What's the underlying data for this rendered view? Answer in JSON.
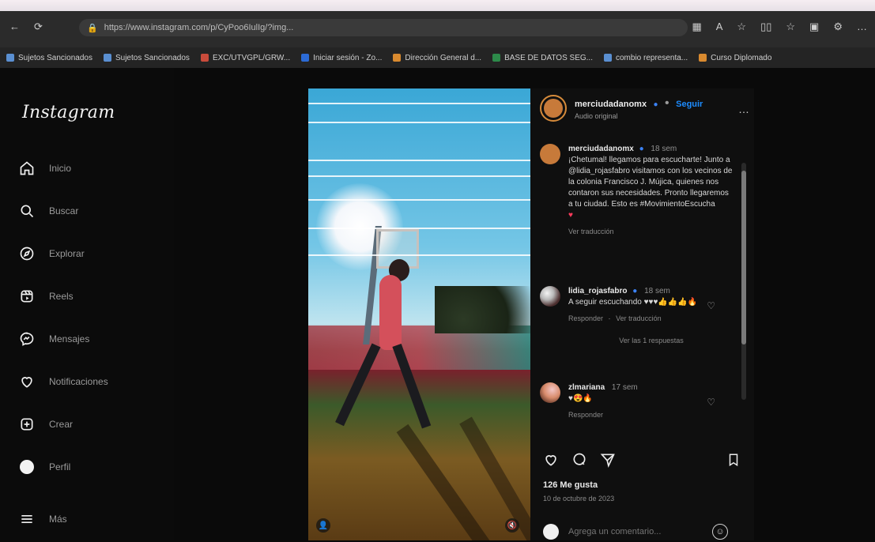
{
  "browser": {
    "url": "https://www.instagram.com/p/CyPoo6IulIg/?img...",
    "bookmarks": [
      "Sujetos Sancionados",
      "Sujetos Sancionados",
      "EXC/UTVGPL/GRW...",
      "Iniciar sesión - Zo...",
      "Dirección General d...",
      "BASE DE DATOS SEG...",
      "combio representa...",
      "Curso Diplomado "
    ]
  },
  "sidebar": {
    "logo": "Instagram",
    "items": [
      {
        "label": "Inicio",
        "icon": "home-icon"
      },
      {
        "label": "Buscar",
        "icon": "search-icon"
      },
      {
        "label": "Explorar",
        "icon": "compass-icon"
      },
      {
        "label": "Reels",
        "icon": "reels-icon"
      },
      {
        "label": "Mensajes",
        "icon": "messenger-icon"
      },
      {
        "label": "Notificaciones",
        "icon": "heart-icon"
      },
      {
        "label": "Crear",
        "icon": "plus-square-icon"
      },
      {
        "label": "Perfil",
        "icon": "profile-avatar"
      },
      {
        "label": "Más",
        "icon": "menu-icon"
      }
    ]
  },
  "post": {
    "username": "merciudadanomx",
    "follow_label": "Seguir",
    "audio": "Audio original",
    "caption_user": "merciudadanomx",
    "caption_time": "18 sem",
    "caption": "¡Chetumal! llegamos para escucharte! Junto a @lidia_rojasfabro visitamos con los vecinos de la colonia Francisco J. Mújica, quienes nos contaron sus necesidades. Pronto llegaremos a tu ciudad. Esto es #MovimientoEscucha",
    "caption_heart": "♥",
    "see_translation": "Ver traducción",
    "comments": [
      {
        "user": "lidia_rojasfabro",
        "time": "18 sem",
        "text": "A seguir escuchando ♥♥♥👍👍👍🔥",
        "reply": "Responder",
        "translate": "Ver traducción",
        "view_replies": "Ver las 1 respuestas"
      },
      {
        "user": "zlmariana",
        "time": "17 sem",
        "text": "♥😍🔥",
        "reply": "Responder"
      }
    ],
    "likes": "126 Me gusta",
    "date": "10 de octubre de 2023",
    "comment_placeholder": "Agrega un comentario..."
  }
}
